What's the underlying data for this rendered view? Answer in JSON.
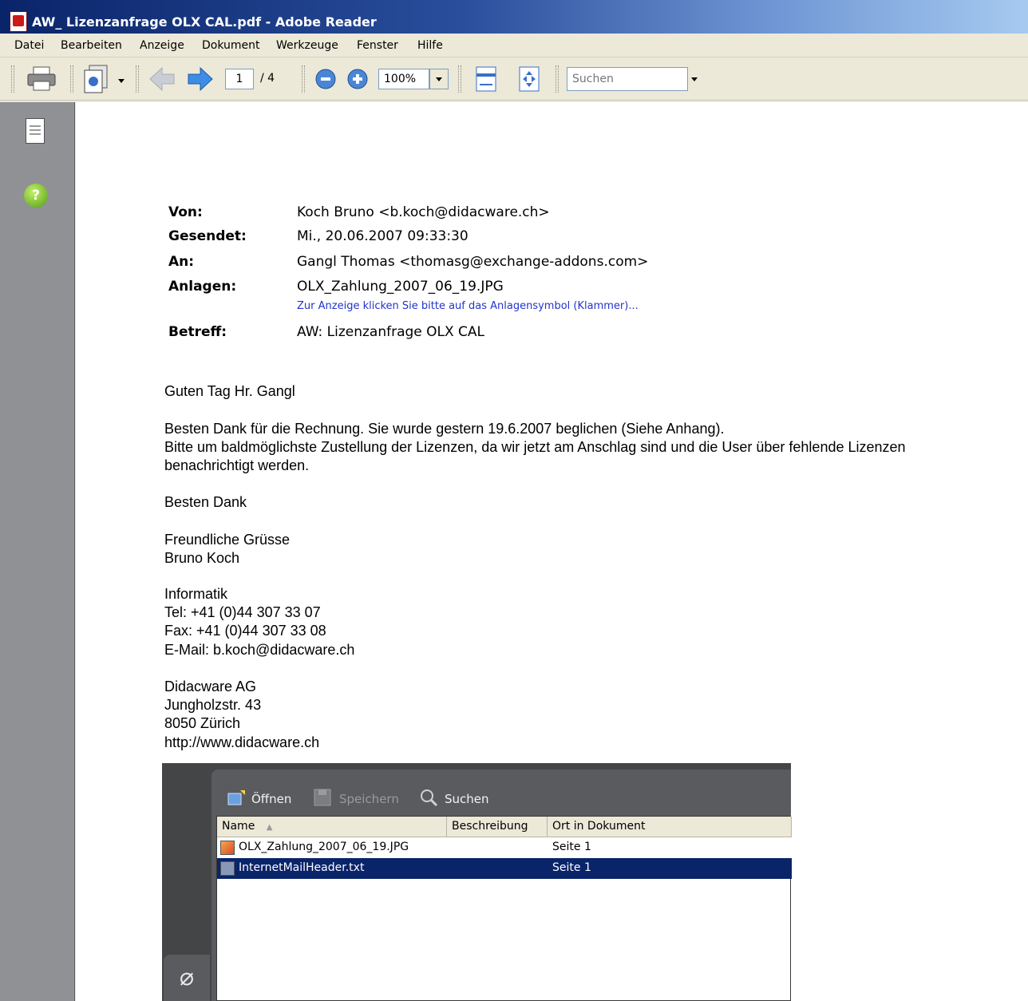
{
  "window": {
    "title": "AW_ Lizenzanfrage OLX CAL.pdf - Adobe Reader"
  },
  "menu": [
    "Datei",
    "Bearbeiten",
    "Anzeige",
    "Dokument",
    "Werkzeuge",
    "Fenster",
    "Hilfe"
  ],
  "toolbar": {
    "page_current": "1",
    "page_total": "/ 4",
    "zoom": "100%",
    "search_placeholder": "Suchen"
  },
  "email": {
    "headers": [
      {
        "label": "Von:",
        "value": "Koch Bruno <b.koch@didacware.ch>"
      },
      {
        "label": "Gesendet:",
        "value": "Mi., 20.06.2007 09:33:30"
      },
      {
        "label": "An:",
        "value": "Gangl Thomas <thomasg@exchange-addons.com>"
      },
      {
        "label": "Anlagen:",
        "value": "OLX_Zahlung_2007_06_19.JPG"
      },
      {
        "label": "Betreff:",
        "value": "AW: Lizenzanfrage OLX CAL"
      }
    ],
    "attachment_hint": "Zur Anzeige klicken Sie bitte auf das Anlagensymbol (Klammer)...",
    "body": [
      "Guten Tag Hr. Gangl",
      "Besten Dank für die Rechnung. Sie wurde gestern 19.6.2007 beglichen (Siehe Anhang).",
      "Bitte um baldmöglichste Zustellung der Lizenzen, da wir jetzt am Anschlag sind und die User über fehlende Lizenzen",
      "benachrichtigt werden.",
      "Besten Dank",
      "Freundliche Grüsse",
      "Bruno Koch",
      "Informatik",
      "Tel: +41 (0)44 307 33 07",
      "Fax: +41 (0)44 307 33 08",
      "E-Mail: b.koch@didacware.ch",
      "Didacware AG",
      "Jungholzstr. 43",
      "8050 Zürich",
      "http://www.didacware.ch"
    ]
  },
  "attachments": {
    "open_label": "Öffnen",
    "save_label": "Speichern",
    "search_label": "Suchen",
    "columns": [
      "Name",
      "Beschreibung",
      "Ort in Dokument"
    ],
    "rows": [
      {
        "name": "OLX_Zahlung_2007_06_19.JPG",
        "description": "",
        "location": "Seite 1"
      },
      {
        "name": "InternetMailHeader.txt",
        "description": "",
        "location": "Seite 1"
      }
    ],
    "selected_row": 1
  },
  "colors": {
    "title_bar": "#0a246a",
    "nav_panel": "#8f9195",
    "selection": "#0a246a",
    "link": "#2233cc"
  },
  "icons": {
    "print": "print-icon",
    "pages": "pages-icon",
    "back": "arrow-left-icon",
    "forward": "arrow-right-icon",
    "zoom_out": "zoom-out-icon",
    "zoom_in": "zoom-in-icon",
    "fit_width": "fit-width-icon",
    "fit_page": "fit-page-icon",
    "help": "help-icon",
    "attachment": "paperclip-icon"
  }
}
